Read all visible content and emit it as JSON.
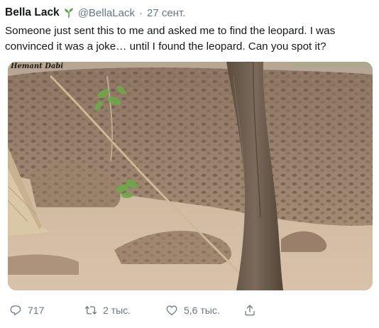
{
  "tweet": {
    "display_name": "Bella Lack",
    "handle": "@BellaLack",
    "separator": "·",
    "date": "27 сент.",
    "text": "Someone just sent this to me and asked me to find the leopard. I was convinced it was a joke… until I found the leopard. Can you spot it?",
    "photo": {
      "watermark": "Hemant Dabi",
      "description_icon": "photo"
    },
    "actions": {
      "reply_count": "717",
      "retweet_count": "2 тыс.",
      "like_count": "5,6 тыс."
    }
  },
  "colors": {
    "text": "#14171a",
    "secondary": "#657786",
    "badge_green": "#5fa44a"
  },
  "icons": [
    "sprout-icon",
    "reply-icon",
    "retweet-icon",
    "like-icon",
    "share-icon"
  ]
}
